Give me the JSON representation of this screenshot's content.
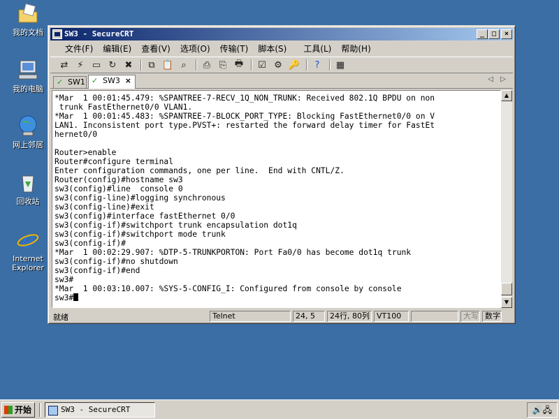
{
  "desktop": {
    "icons": [
      {
        "label": "我的文档",
        "icon": "folder-icon"
      },
      {
        "label": "我的电脑",
        "icon": "computer-icon"
      },
      {
        "label": "网上邻居",
        "icon": "network-icon"
      },
      {
        "label": "回收站",
        "icon": "recycle-bin-icon"
      },
      {
        "label1": "Internet",
        "label2": "Explorer",
        "icon": "ie-icon"
      }
    ]
  },
  "window": {
    "title": "SW3 - SecureCRT",
    "min": "_",
    "max": "□",
    "close": "×"
  },
  "menu": [
    "文件(F)",
    "编辑(E)",
    "查看(V)",
    "选项(O)",
    "传输(T)",
    "脚本(S)",
    "工具(L)",
    "帮助(H)"
  ],
  "tabs": [
    {
      "label": "SW1",
      "active": false
    },
    {
      "label": "SW3",
      "active": true,
      "close": "×"
    }
  ],
  "tab_nav": {
    "prev": "◁",
    "next": "▷"
  },
  "terminal": {
    "lines": [
      "*Mar  1 00:01:45.479: %SPANTREE-7-RECV_1Q_NON_TRUNK: Received 802.1Q BPDU on non",
      " trunk FastEthernet0/0 VLAN1.",
      "*Mar  1 00:01:45.483: %SPANTREE-7-BLOCK_PORT_TYPE: Blocking FastEthernet0/0 on V",
      "LAN1. Inconsistent port type.PVST+: restarted the forward delay timer for FastEt",
      "hernet0/0",
      "",
      "Router>enable",
      "Router#configure terminal",
      "Enter configuration commands, one per line.  End with CNTL/Z.",
      "Router(config)#hostname sw3",
      "sw3(config)#line  console 0",
      "sw3(config-line)#logging synchronous",
      "sw3(config-line)#exit",
      "sw3(config)#interface fastEthernet 0/0",
      "sw3(config-if)#switchport trunk encapsulation dot1q",
      "sw3(config-if)#switchport mode trunk",
      "sw3(config-if)#",
      "*Mar  1 00:02:29.907: %DTP-5-TRUNKPORTON: Port Fa0/0 has become dot1q trunk",
      "sw3(config-if)#no shutdown",
      "sw3(config-if)#end",
      "sw3#",
      "*Mar  1 00:03:10.007: %SYS-5-CONFIG_I: Configured from console by console"
    ],
    "prompt": "sw3#"
  },
  "status": {
    "ready": "就绪",
    "protocol": "Telnet",
    "position": "24,  5",
    "size": "24行, 80列",
    "emulation": "VT100",
    "caps": "大写",
    "num": "数字"
  },
  "taskbar": {
    "start": "开始",
    "task": "SW3 - SecureCRT"
  }
}
